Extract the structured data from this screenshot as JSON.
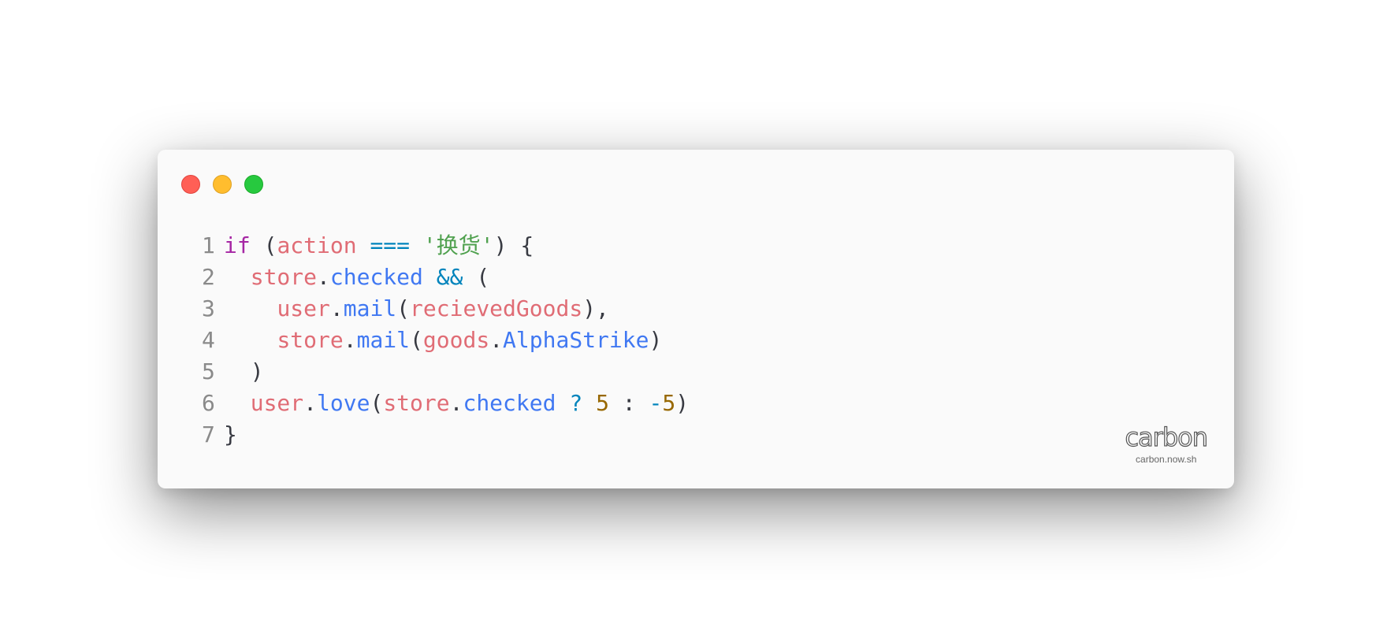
{
  "window": {
    "controls": [
      "close",
      "minimize",
      "maximize"
    ],
    "colors": {
      "background": "#fafafa",
      "close": "#ff5f56",
      "minimize": "#ffbd2e",
      "maximize": "#27c93f"
    }
  },
  "code": {
    "language": "javascript",
    "lines": [
      [
        {
          "t": "if",
          "c": "kw"
        },
        {
          "t": " (",
          "c": "pn"
        },
        {
          "t": "action",
          "c": "var"
        },
        {
          "t": " ",
          "c": "pn"
        },
        {
          "t": "===",
          "c": "op"
        },
        {
          "t": " ",
          "c": "pn"
        },
        {
          "t": "'换货'",
          "c": "str"
        },
        {
          "t": ") {",
          "c": "pn"
        }
      ],
      [
        {
          "t": "  ",
          "c": "pn"
        },
        {
          "t": "store",
          "c": "var"
        },
        {
          "t": ".",
          "c": "pn"
        },
        {
          "t": "checked",
          "c": "prop"
        },
        {
          "t": " ",
          "c": "pn"
        },
        {
          "t": "&&",
          "c": "op"
        },
        {
          "t": " (",
          "c": "pn"
        }
      ],
      [
        {
          "t": "    ",
          "c": "pn"
        },
        {
          "t": "user",
          "c": "var"
        },
        {
          "t": ".",
          "c": "pn"
        },
        {
          "t": "mail",
          "c": "prop"
        },
        {
          "t": "(",
          "c": "pn"
        },
        {
          "t": "recievedGoods",
          "c": "var"
        },
        {
          "t": "),",
          "c": "pn"
        }
      ],
      [
        {
          "t": "    ",
          "c": "pn"
        },
        {
          "t": "store",
          "c": "var"
        },
        {
          "t": ".",
          "c": "pn"
        },
        {
          "t": "mail",
          "c": "prop"
        },
        {
          "t": "(",
          "c": "pn"
        },
        {
          "t": "goods",
          "c": "var"
        },
        {
          "t": ".",
          "c": "pn"
        },
        {
          "t": "AlphaStrike",
          "c": "prop"
        },
        {
          "t": ")",
          "c": "pn"
        }
      ],
      [
        {
          "t": "  )",
          "c": "pn"
        }
      ],
      [
        {
          "t": "  ",
          "c": "pn"
        },
        {
          "t": "user",
          "c": "var"
        },
        {
          "t": ".",
          "c": "pn"
        },
        {
          "t": "love",
          "c": "prop"
        },
        {
          "t": "(",
          "c": "pn"
        },
        {
          "t": "store",
          "c": "var"
        },
        {
          "t": ".",
          "c": "pn"
        },
        {
          "t": "checked",
          "c": "prop"
        },
        {
          "t": " ",
          "c": "pn"
        },
        {
          "t": "?",
          "c": "op"
        },
        {
          "t": " ",
          "c": "pn"
        },
        {
          "t": "5",
          "c": "num"
        },
        {
          "t": " : ",
          "c": "pn"
        },
        {
          "t": "-",
          "c": "op"
        },
        {
          "t": "5",
          "c": "num"
        },
        {
          "t": ")",
          "c": "pn"
        }
      ],
      [
        {
          "t": "}",
          "c": "pn"
        }
      ]
    ],
    "line_numbers": [
      "1",
      "2",
      "3",
      "4",
      "5",
      "6",
      "7"
    ]
  },
  "brand": {
    "logo": "carbon",
    "url": "carbon.now.sh"
  }
}
